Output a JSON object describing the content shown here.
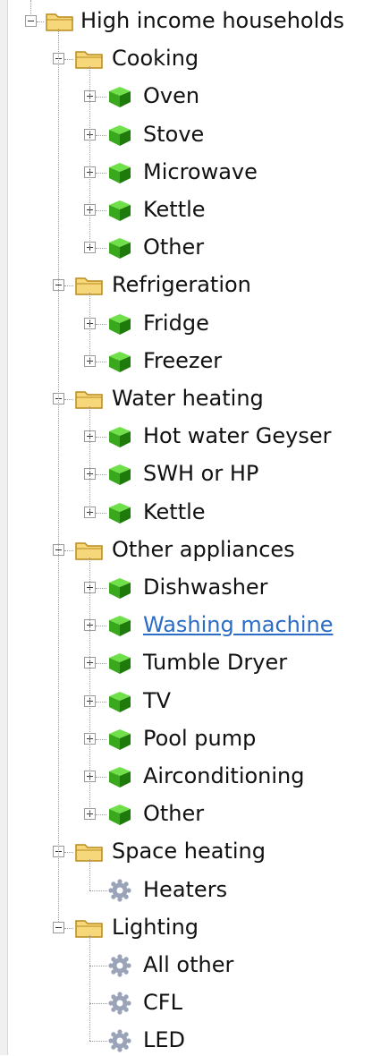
{
  "tree": {
    "root": {
      "label": "High income households",
      "icon": "folder-icon",
      "expanded": true
    },
    "groups": [
      {
        "label": "Cooking",
        "icon": "folder-icon",
        "expanded": true,
        "items": [
          {
            "label": "Oven",
            "icon": "cube-icon",
            "expander": true
          },
          {
            "label": "Stove",
            "icon": "cube-icon",
            "expander": true
          },
          {
            "label": "Microwave",
            "icon": "cube-icon",
            "expander": true
          },
          {
            "label": "Kettle",
            "icon": "cube-icon",
            "expander": true
          },
          {
            "label": "Other",
            "icon": "cube-icon",
            "expander": true
          }
        ]
      },
      {
        "label": "Refrigeration",
        "icon": "folder-icon",
        "expanded": true,
        "items": [
          {
            "label": "Fridge",
            "icon": "cube-icon",
            "expander": true
          },
          {
            "label": "Freezer",
            "icon": "cube-icon",
            "expander": true
          }
        ]
      },
      {
        "label": "Water heating",
        "icon": "folder-icon",
        "expanded": true,
        "items": [
          {
            "label": "Hot water Geyser",
            "icon": "cube-icon",
            "expander": true
          },
          {
            "label": "SWH or HP",
            "icon": "cube-icon",
            "expander": true
          },
          {
            "label": "Kettle",
            "icon": "cube-icon",
            "expander": true
          }
        ]
      },
      {
        "label": "Other appliances",
        "icon": "folder-icon",
        "expanded": true,
        "items": [
          {
            "label": "Dishwasher",
            "icon": "cube-icon",
            "expander": true
          },
          {
            "label": "Washing machine",
            "icon": "cube-icon",
            "expander": true,
            "hovered": true
          },
          {
            "label": "Tumble Dryer",
            "icon": "cube-icon",
            "expander": true
          },
          {
            "label": "TV",
            "icon": "cube-icon",
            "expander": true
          },
          {
            "label": "Pool pump",
            "icon": "cube-icon",
            "expander": true
          },
          {
            "label": "Airconditioning",
            "icon": "cube-icon",
            "expander": true
          },
          {
            "label": "Other",
            "icon": "cube-icon",
            "expander": true
          }
        ]
      },
      {
        "label": "Space heating",
        "icon": "folder-icon",
        "expanded": true,
        "items": [
          {
            "label": "Heaters",
            "icon": "gear-icon",
            "expander": false
          }
        ]
      },
      {
        "label": "Lighting",
        "icon": "folder-icon",
        "expanded": true,
        "items": [
          {
            "label": "All other",
            "icon": "gear-icon",
            "expander": false
          },
          {
            "label": "CFL",
            "icon": "gear-icon",
            "expander": false
          },
          {
            "label": "LED",
            "icon": "gear-icon",
            "expander": false
          }
        ]
      }
    ]
  },
  "colors": {
    "cube_top": "#6fe04a",
    "cube_front": "#3aa81c",
    "cube_side": "#1f7a0c",
    "folder_fill": "#f6d77a",
    "folder_edge": "#b88a1c",
    "gear": "#9aa3b8",
    "link": "#2b6cc4"
  }
}
